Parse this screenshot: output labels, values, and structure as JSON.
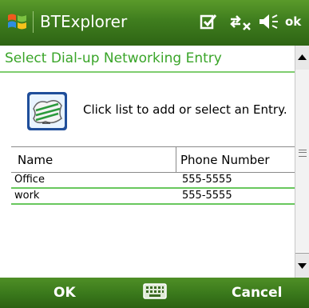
{
  "titlebar": {
    "app_title": "BTExplorer",
    "ok_label": "ok",
    "icons": [
      "windows-start-icon",
      "notes-icon",
      "connectivity-icon",
      "volume-muted-icon"
    ]
  },
  "dialog": {
    "heading": "Select Dial-up Networking Entry",
    "instruction": "Click list to add or select an Entry.",
    "icon": "dial-up-entry-icon"
  },
  "table": {
    "columns": [
      "Name",
      "Phone Number"
    ],
    "rows": [
      {
        "name": "Office",
        "phone": "555-5555"
      },
      {
        "name": "work",
        "phone": "555-5555"
      }
    ]
  },
  "softkeys": {
    "left": "OK",
    "right": "Cancel",
    "center_icon": "keyboard-icon"
  },
  "colors": {
    "accent_green": "#3aa529",
    "bar_green": "#3f7d1e",
    "row_separator": "#68c75e"
  }
}
